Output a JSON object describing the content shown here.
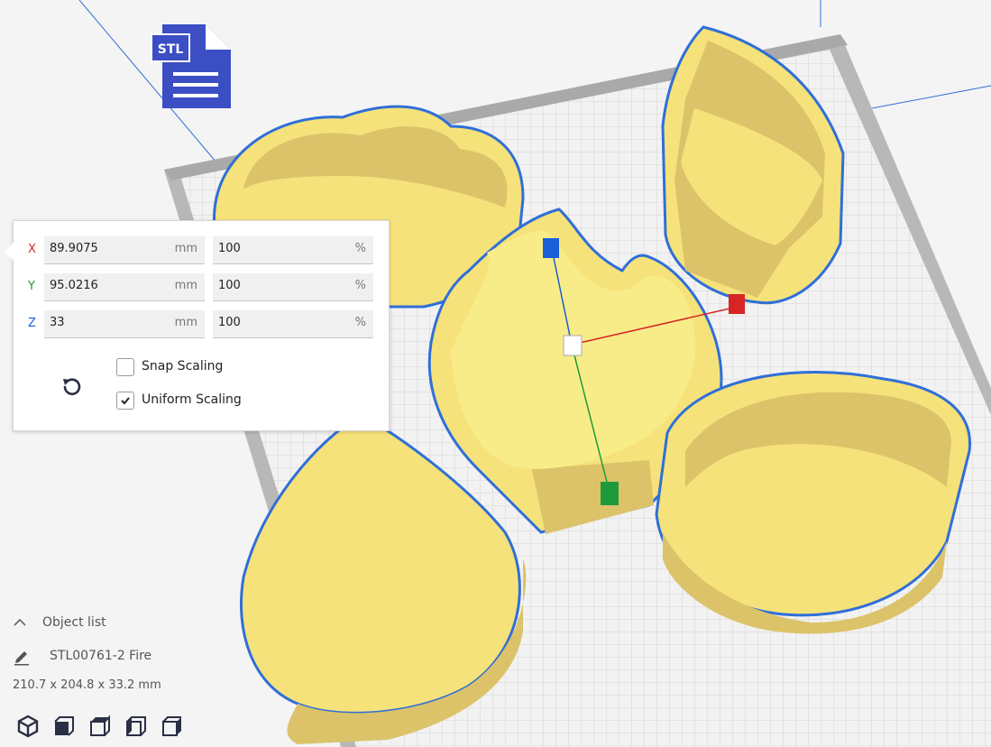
{
  "scale_panel": {
    "x": {
      "axis": "X",
      "value": "89.9075",
      "unit": "mm",
      "percent": "100",
      "percent_unit": "%"
    },
    "y": {
      "axis": "Y",
      "value": "95.0216",
      "unit": "mm",
      "percent": "100",
      "percent_unit": "%"
    },
    "z": {
      "axis": "Z",
      "value": "33",
      "unit": "mm",
      "percent": "100",
      "percent_unit": "%"
    },
    "snap_scaling": {
      "label": "Snap Scaling",
      "checked": false
    },
    "uniform_scaling": {
      "label": "Uniform Scaling",
      "checked": true
    },
    "reset_icon": "reset-icon"
  },
  "object_list": {
    "header": "Object list",
    "item_name": "STL00761-2 Fire",
    "dimensions": "210.7 x 204.8 x 33.2 mm"
  },
  "file_badge": {
    "label": "STL"
  },
  "view_buttons": [
    "3d-view-icon",
    "front-view-icon",
    "top-view-icon",
    "left-view-icon",
    "right-view-icon"
  ],
  "colors": {
    "model": "#f6e27a",
    "model_side": "#dcc36a",
    "selection_outline": "#2f6fd8",
    "axis_x": "#d62525",
    "axis_y": "#1f9a3a",
    "axis_z": "#1a5fd6",
    "bed_grid": "#e2e2e2",
    "bed_border": "#b4b4b4",
    "file_badge": "#3b4ec4"
  }
}
